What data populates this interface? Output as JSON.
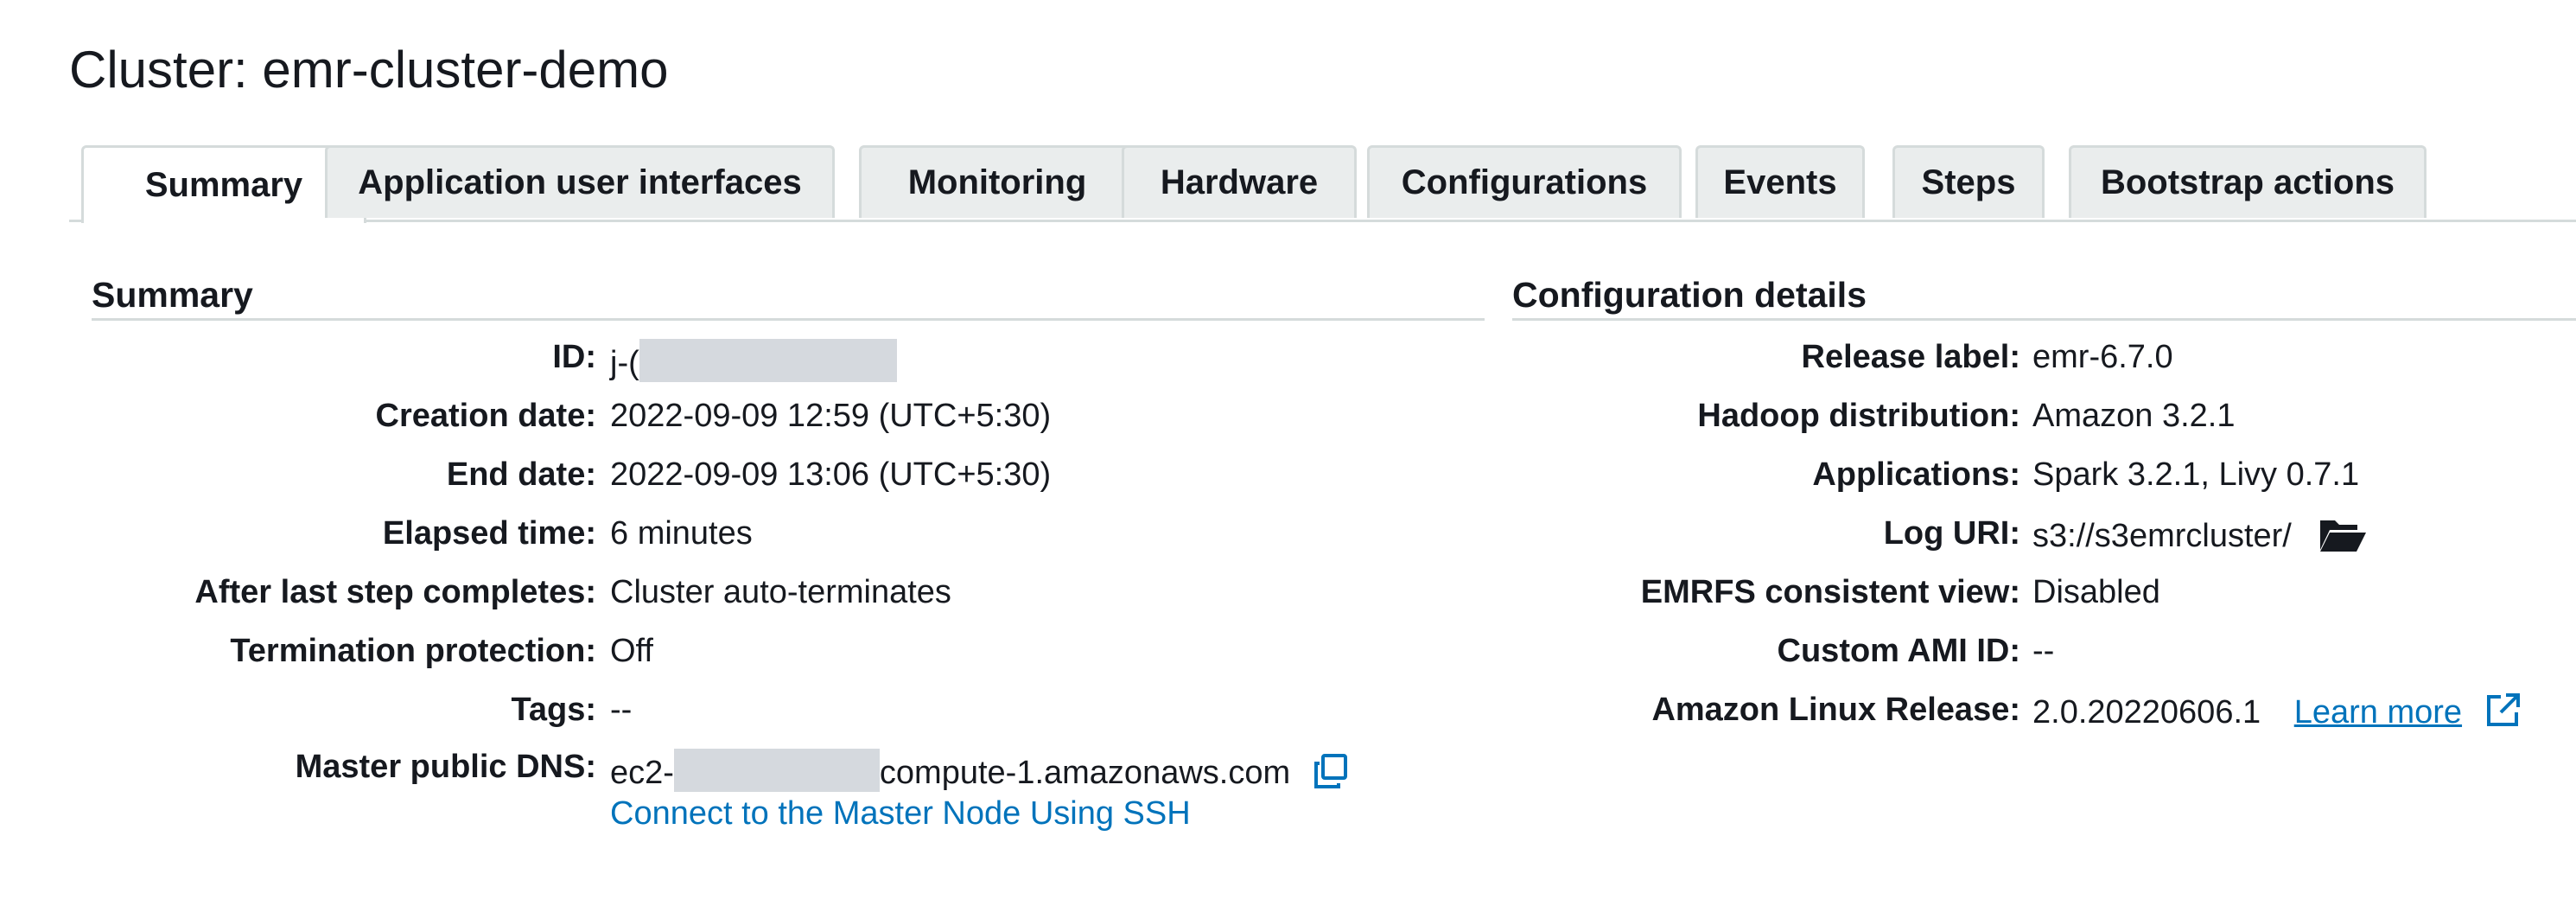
{
  "cluster": {
    "title": "Cluster: emr-cluster-demo"
  },
  "tabs": [
    {
      "label": "Summary",
      "active": true
    },
    {
      "label": "Application user interfaces"
    },
    {
      "label": "Monitoring"
    },
    {
      "label": "Hardware"
    },
    {
      "label": "Configurations"
    },
    {
      "label": "Events"
    },
    {
      "label": "Steps"
    },
    {
      "label": "Bootstrap actions"
    }
  ],
  "summary": {
    "heading": "Summary",
    "id": {
      "label": "ID:",
      "value_prefix": "j-("
    },
    "creation_date": {
      "label": "Creation date:",
      "value": "2022-09-09 12:59 (UTC+5:30)"
    },
    "end_date": {
      "label": "End date:",
      "value": "2022-09-09 13:06 (UTC+5:30)"
    },
    "elapsed_time": {
      "label": "Elapsed time:",
      "value": "6 minutes"
    },
    "after_last_step": {
      "label": "After last step completes:",
      "value": "Cluster auto-terminates"
    },
    "termination_protection": {
      "label": "Termination protection:",
      "value": "Off"
    },
    "tags": {
      "label": "Tags:",
      "value": "--"
    },
    "master_dns": {
      "label": "Master public DNS:",
      "value_prefix": "ec2-",
      "value_suffix": "compute-1.amazonaws.com",
      "icon": "copy-icon"
    },
    "ssh_link": "Connect to the Master Node Using SSH"
  },
  "config": {
    "heading": "Configuration details",
    "release_label": {
      "label": "Release label:",
      "value": "emr-6.7.0"
    },
    "hadoop": {
      "label": "Hadoop distribution:",
      "value": "Amazon 3.2.1"
    },
    "applications": {
      "label": "Applications:",
      "value": "Spark 3.2.1, Livy 0.7.1"
    },
    "log_uri": {
      "label": "Log URI:",
      "value": "s3://s3emrcluster/",
      "icon": "folder-open-icon"
    },
    "emrfs": {
      "label": "EMRFS consistent view:",
      "value": "Disabled"
    },
    "custom_ami": {
      "label": "Custom AMI ID:",
      "value": "--"
    },
    "linux_release": {
      "label": "Amazon Linux Release:",
      "value": "2.0.20220606.1",
      "link": "Learn more",
      "icon": "external-link-icon"
    }
  },
  "colors": {
    "link": "#0073bb",
    "tab_bg": "#eaeded",
    "border": "#d5dbdb",
    "redaction": "#d5d9de"
  }
}
